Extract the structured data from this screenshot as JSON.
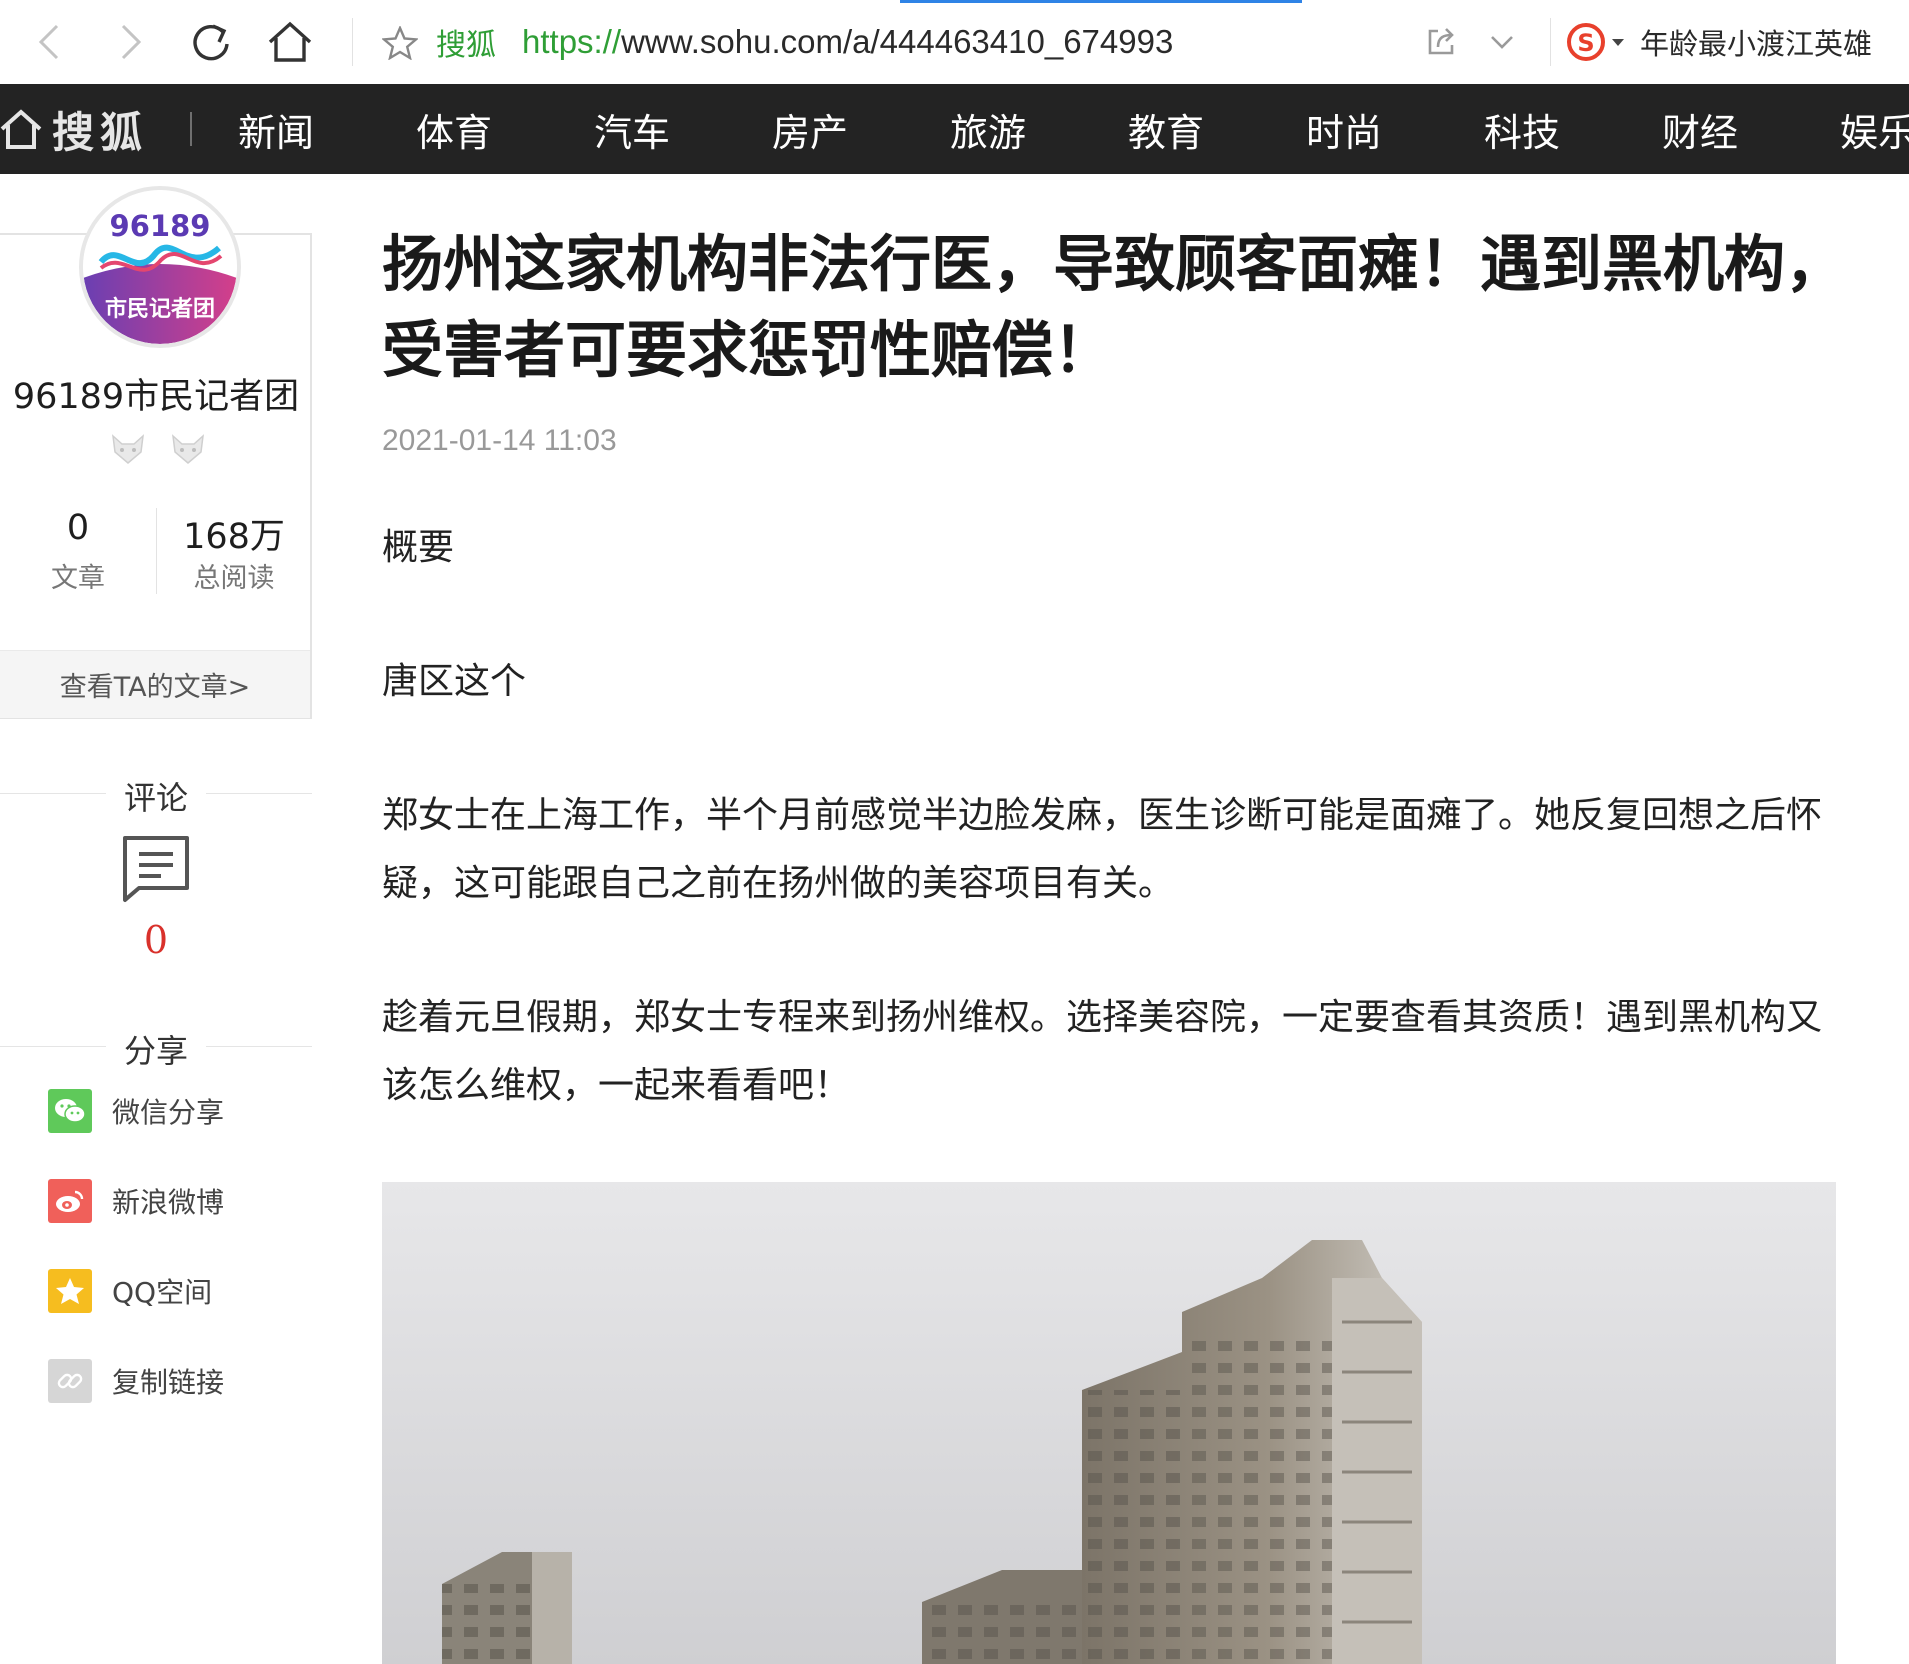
{
  "browser": {
    "site_name": "搜狐",
    "url_scheme": "https://",
    "url_rest": "www.sohu.com/a/444463410_674993",
    "hot_search": "年龄最小渡江英雄",
    "accent_color": "#2f9e36"
  },
  "sohu_nav": {
    "logo": "搜狐",
    "items": [
      "新闻",
      "体育",
      "汽车",
      "房产",
      "旅游",
      "教育",
      "时尚",
      "科技",
      "财经",
      "娱乐"
    ]
  },
  "author": {
    "avatar_number": "96189",
    "avatar_caption": "市民记者团",
    "name": "96189市民记者团",
    "stats": [
      {
        "value": "0",
        "label": "文章"
      },
      {
        "value": "168万",
        "label": "总阅读"
      }
    ],
    "view_articles": "查看TA的文章>"
  },
  "comments": {
    "title": "评论",
    "count": "0"
  },
  "share": {
    "title": "分享",
    "items": [
      {
        "label": "微信分享",
        "icon": "wechat-icon",
        "color": "#5fc95a"
      },
      {
        "label": "新浪微博",
        "icon": "weibo-icon",
        "color": "#f0605a"
      },
      {
        "label": "QQ空间",
        "icon": "qzone-star-icon",
        "color": "#f6bd1f"
      },
      {
        "label": "复制链接",
        "icon": "link-icon",
        "color": "#d6d6d6"
      }
    ]
  },
  "article": {
    "title": "扬州这家机构非法行医，导致顾客面瘫！遇到黑机构，受害者可要求惩罚性赔偿！",
    "date": "2021-01-14 11:03",
    "paragraphs": [
      "概要",
      "唐区这个",
      "郑女士在上海工作，半个月前感觉半边脸发麻，医生诊断可能是面瘫了。她反复回想之后怀疑，这可能跟自己之前在扬州做的美容项目有关。",
      "趁着元旦假期，郑女士专程来到扬州维权。选择美容院，一定要查看其资质！遇到黑机构又该怎么维权，一起来看看吧！"
    ]
  }
}
